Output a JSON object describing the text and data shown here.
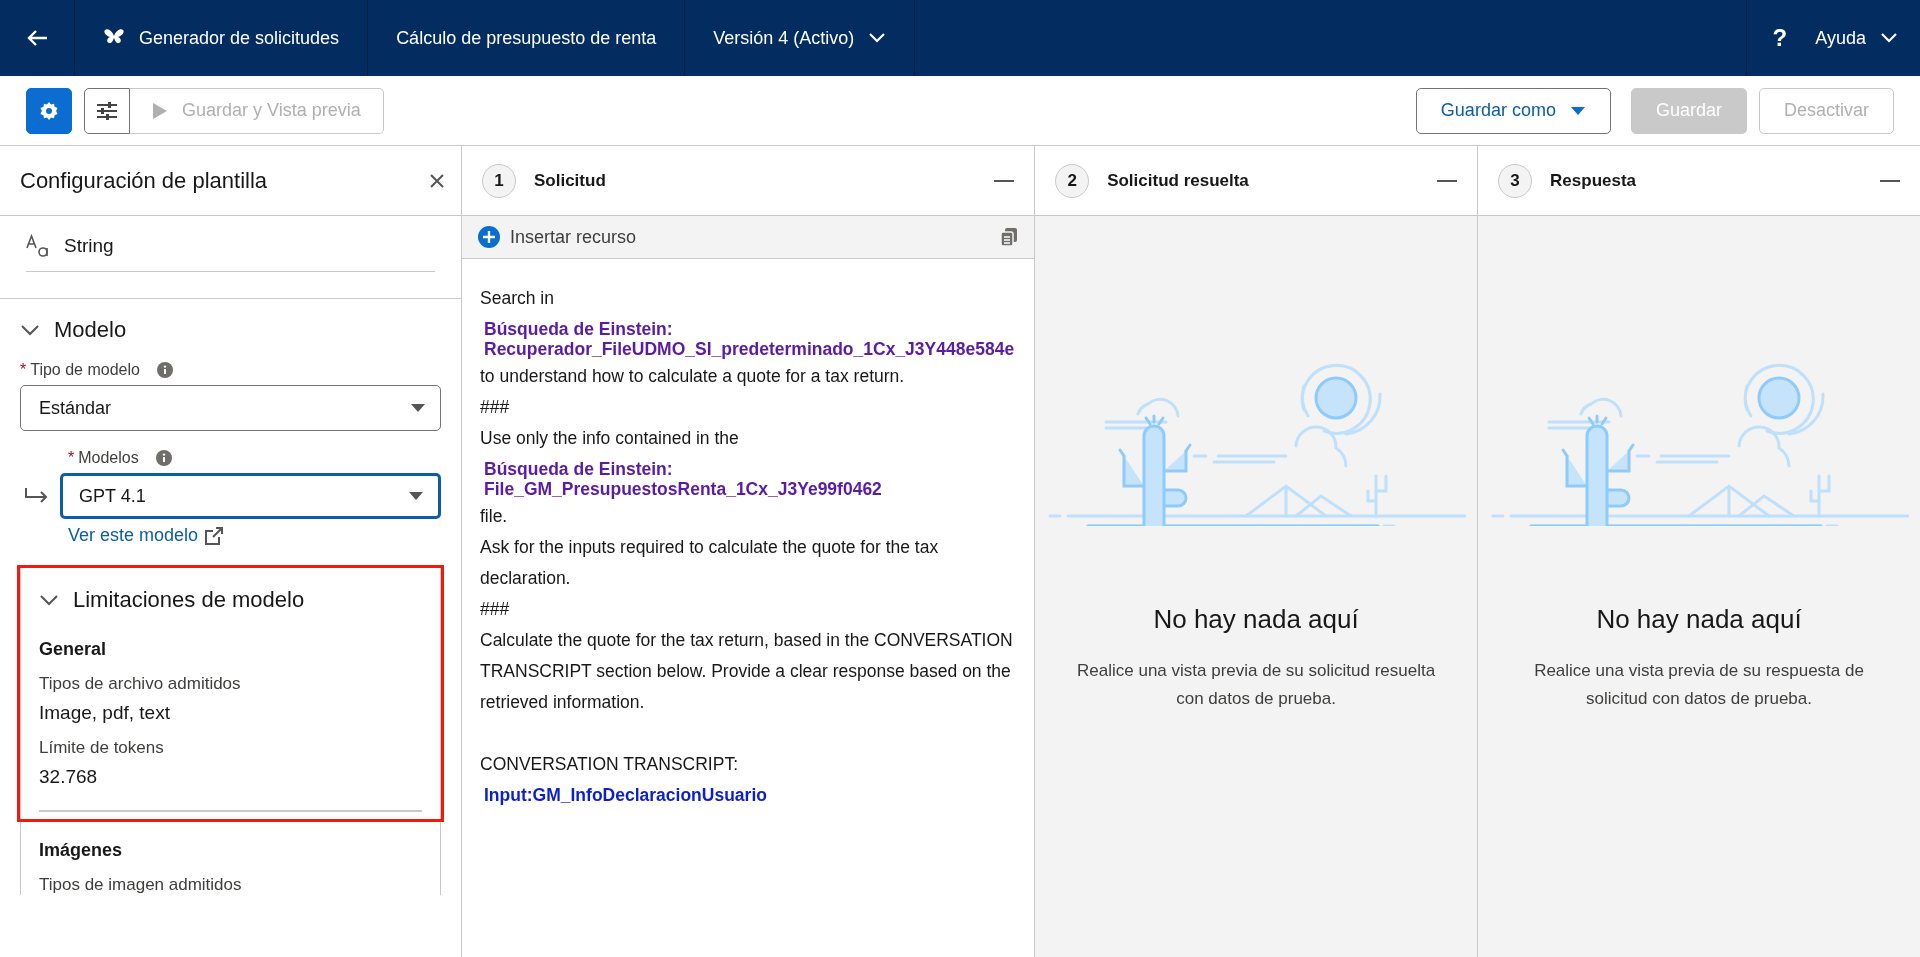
{
  "top_bar": {
    "app_title": "Generador de solicitudes",
    "template_name": "Cálculo de presupuesto de renta",
    "version": "Versión 4 (Activo)",
    "help_glyph": "?",
    "help_label": "Ayuda"
  },
  "toolbar": {
    "settings_selected": true,
    "preview_button": {
      "label": "Guardar y Vista previa",
      "disabled": true
    },
    "buttons": [
      {
        "label": "Guardar como",
        "kind": "menu",
        "disabled": false
      },
      {
        "label": "Guardar",
        "kind": "brand",
        "disabled": true
      },
      {
        "label": "Desactivar",
        "kind": "outline",
        "disabled": true
      }
    ]
  },
  "sidebar": {
    "title": "Configuración de plantilla",
    "data_type": "String",
    "model_section": {
      "title": "Modelo",
      "expanded": true,
      "required_glyph": "*",
      "fields": [
        {
          "label": "Tipo de modelo",
          "required": true,
          "value": "Estándar",
          "focused": false,
          "nested": false
        },
        {
          "label": "Modelos",
          "required": true,
          "value": "GPT 4.1",
          "focused": true,
          "nested": true
        }
      ],
      "link": "Ver este modelo"
    },
    "limits_section": {
      "title": "Limitaciones de modelo",
      "expanded": true,
      "highlighted": true,
      "groups": [
        {
          "heading": "General",
          "items": [
            {
              "label": "Tipos de archivo admitidos",
              "value": "Image, pdf, text"
            },
            {
              "label": "Límite de tokens",
              "value": "32.768"
            }
          ]
        },
        {
          "heading": "Imágenes",
          "items": [
            {
              "label": "Tipos de imagen admitidos"
            }
          ]
        }
      ]
    }
  },
  "columns": [
    {
      "number": "1",
      "title": "Solicitud",
      "kind": "editor",
      "insert_label": "Insertar recurso",
      "prompt": [
        {
          "kind": "text",
          "text": "Search in"
        },
        {
          "kind": "resource",
          "text": "Búsqueda de Einstein: Recuperador_FileUDMO_SI_predeterminado_1Cx_J3Y448e584e"
        },
        {
          "kind": "text",
          "text": "to understand how to calculate a quote for a tax return."
        },
        {
          "kind": "text",
          "text": "###"
        },
        {
          "kind": "text",
          "text": "Use only the info contained in the"
        },
        {
          "kind": "resource",
          "text": "Búsqueda de Einstein: File_GM_PresupuestosRenta_1Cx_J3Ye99f0462"
        },
        {
          "kind": "text",
          "text": "file."
        },
        {
          "kind": "text",
          "text": "Ask for the inputs required to calculate the quote for the tax declaration."
        },
        {
          "kind": "text",
          "text": "###"
        },
        {
          "kind": "text",
          "text": "Calculate the quote for the tax return, based in the CONVERSATION TRANSCRIPT section below. Provide a clear response based on the retrieved information."
        },
        {
          "kind": "blank"
        },
        {
          "kind": "text",
          "text": "CONVERSATION TRANSCRIPT:"
        },
        {
          "kind": "input",
          "text": "Input:GM_InfoDeclaracionUsuario"
        }
      ]
    },
    {
      "number": "2",
      "title": "Solicitud resuelta",
      "kind": "empty",
      "empty_title": "No hay nada aquí",
      "empty_text": "Realice una vista previa de su solicitud resuelta con datos de prueba."
    },
    {
      "number": "3",
      "title": "Respuesta",
      "kind": "empty",
      "empty_title": "No hay nada aquí",
      "empty_text": "Realice una vista previa de su respuesta de solicitud con datos de prueba."
    }
  ]
}
